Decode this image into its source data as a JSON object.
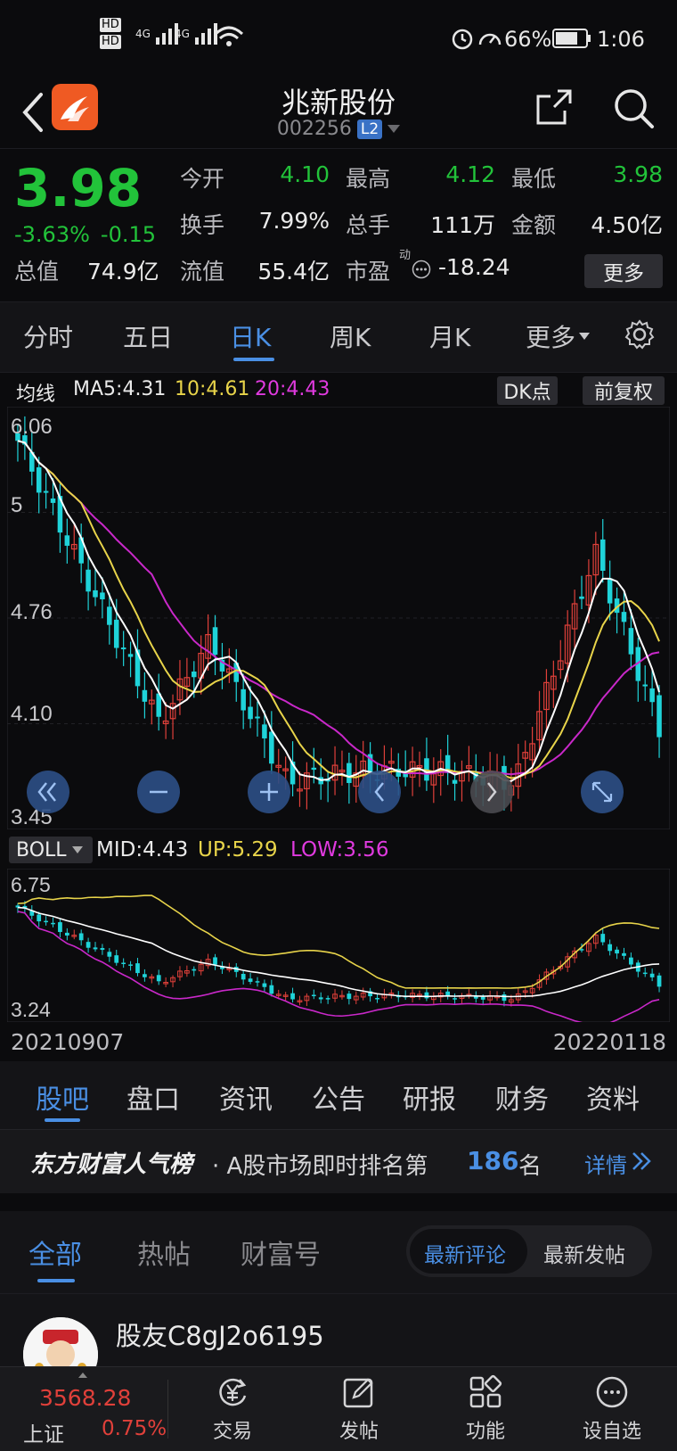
{
  "status_bar": {
    "hd1": "HD",
    "hd2": "HD",
    "net1": "4G",
    "net2": "4G",
    "battery": "66%",
    "time": "1:06"
  },
  "header": {
    "title": "兆新股份",
    "code": "002256",
    "level": "L2"
  },
  "quote": {
    "price": "3.98",
    "change_pct": "-3.63%",
    "change": "-0.15",
    "fields": [
      {
        "label": "今开",
        "value": "4.10"
      },
      {
        "label": "最高",
        "value": "4.12"
      },
      {
        "label": "最低",
        "value": "3.98"
      },
      {
        "label": "换手",
        "value": "7.99%"
      },
      {
        "label": "总手",
        "value": "111万"
      },
      {
        "label": "金额",
        "value": "4.50亿"
      },
      {
        "label": "总值",
        "value": "74.9亿"
      },
      {
        "label": "流值",
        "value": "55.4亿"
      },
      {
        "label": "市盈",
        "value": "-18.24"
      }
    ],
    "pe_sup": "动",
    "more": "更多"
  },
  "ktabs": [
    "分时",
    "五日",
    "日K",
    "周K",
    "月K",
    "更多"
  ],
  "ma": {
    "label": "均线",
    "ma5": "MA5:4.31",
    "ma10": "10:4.61",
    "ma20": "20:4.43",
    "dk": "DK点",
    "adjust": "前复权"
  },
  "main_chart": {
    "y_labels": [
      "6.06",
      "5",
      "4.76",
      "4.10",
      "3.45"
    ]
  },
  "boll": {
    "label": "BOLL",
    "mid": "MID:4.43",
    "up": "UP:5.29",
    "low": "LOW:3.56",
    "y_top": "6.75",
    "y_bottom": "3.24"
  },
  "dates": {
    "start": "20210907",
    "end": "20220118"
  },
  "info_tabs": [
    "股吧",
    "盘口",
    "资讯",
    "公告",
    "研报",
    "财务",
    "资料"
  ],
  "rank": {
    "brand": "东方财富人气榜",
    "text": "· A股市场即时排名第",
    "num": "186",
    "unit": "名",
    "detail": "详情"
  },
  "sub_tabs": [
    "全部",
    "热帖",
    "财富号"
  ],
  "seg": [
    "最新评论",
    "最新发帖"
  ],
  "post": {
    "user": "股友C8gJ2o6195"
  },
  "bottom_bar": {
    "index_value": "3568.28",
    "index_name": "上证",
    "index_pct": "0.75%",
    "items": [
      "交易",
      "发帖",
      "功能",
      "设自选"
    ]
  },
  "colors": {
    "up": "#e0403a",
    "down": "#1fd3d9",
    "green": "#22c33a",
    "accent": "#4a8fe4"
  }
}
